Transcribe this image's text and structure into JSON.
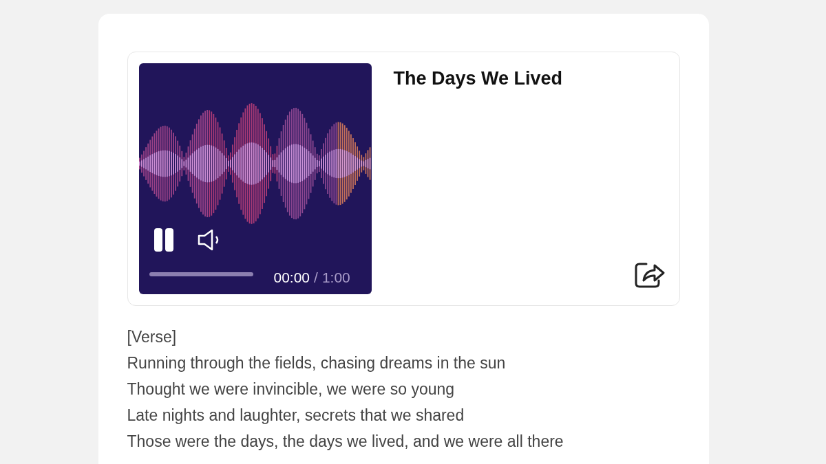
{
  "player": {
    "title": "The Days We Lived",
    "playing": true,
    "progress": {
      "level": 0
    },
    "current_time": "00:00",
    "separator": "/",
    "duration": "1:00"
  },
  "lyrics": [
    "[Verse]",
    "Running through the fields, chasing dreams in the sun",
    "Thought we were invincible, we were so young",
    "Late nights and laughter, secrets that we shared",
    "Those were the days, the days we lived, and we were all there"
  ]
}
